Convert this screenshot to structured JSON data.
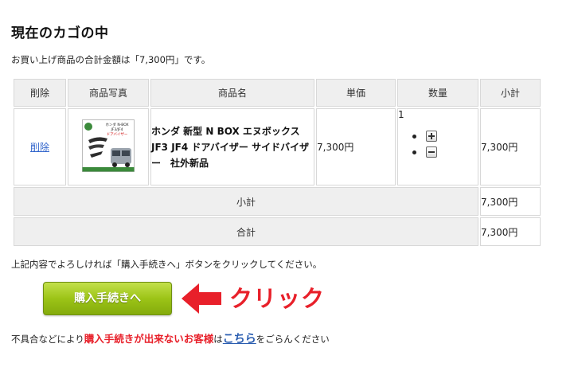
{
  "page": {
    "title": "現在のカゴの中",
    "total_message": "お買い上げ商品の合計金額は「7,300円」です。"
  },
  "table": {
    "headers": {
      "delete": "削除",
      "photo": "商品写真",
      "name": "商品名",
      "unit_price": "単価",
      "quantity": "数量",
      "subtotal": "小計"
    },
    "items": [
      {
        "delete_link": "削除",
        "image_label_1": "ホンダ N-BOX",
        "image_label_2": "JF3/JF4",
        "image_label_3": "ドアバイザー",
        "name": "ホンダ 新型 N BOX エヌボックス JF3 JF4 ドアバイザー サイドバイザー　社外新品",
        "unit_price": "7,300円",
        "quantity": "1",
        "subtotal": "7,300円"
      }
    ],
    "summary": {
      "subtotal_label": "小計",
      "subtotal_value": "7,300円",
      "total_label": "合計",
      "total_value": "7,300円"
    }
  },
  "instruction": "上記内容でよろしければ「購入手続きへ」ボタンをクリックしてください。",
  "buy_button": "購入手続きへ",
  "click_annotation": "クリック",
  "footer": {
    "prefix": "不具合などにより",
    "highlight": "購入手続きが出来ないお客様",
    "middle": "は",
    "link": "こちら",
    "suffix": "をごらんください"
  },
  "colors": {
    "button_green": "#9cc417",
    "annotation_red": "#e8202a",
    "header_gray": "#efefef",
    "link_blue": "#2a5db0"
  },
  "icons": [
    "plus-icon",
    "minus-icon",
    "left-arrow-icon"
  ]
}
